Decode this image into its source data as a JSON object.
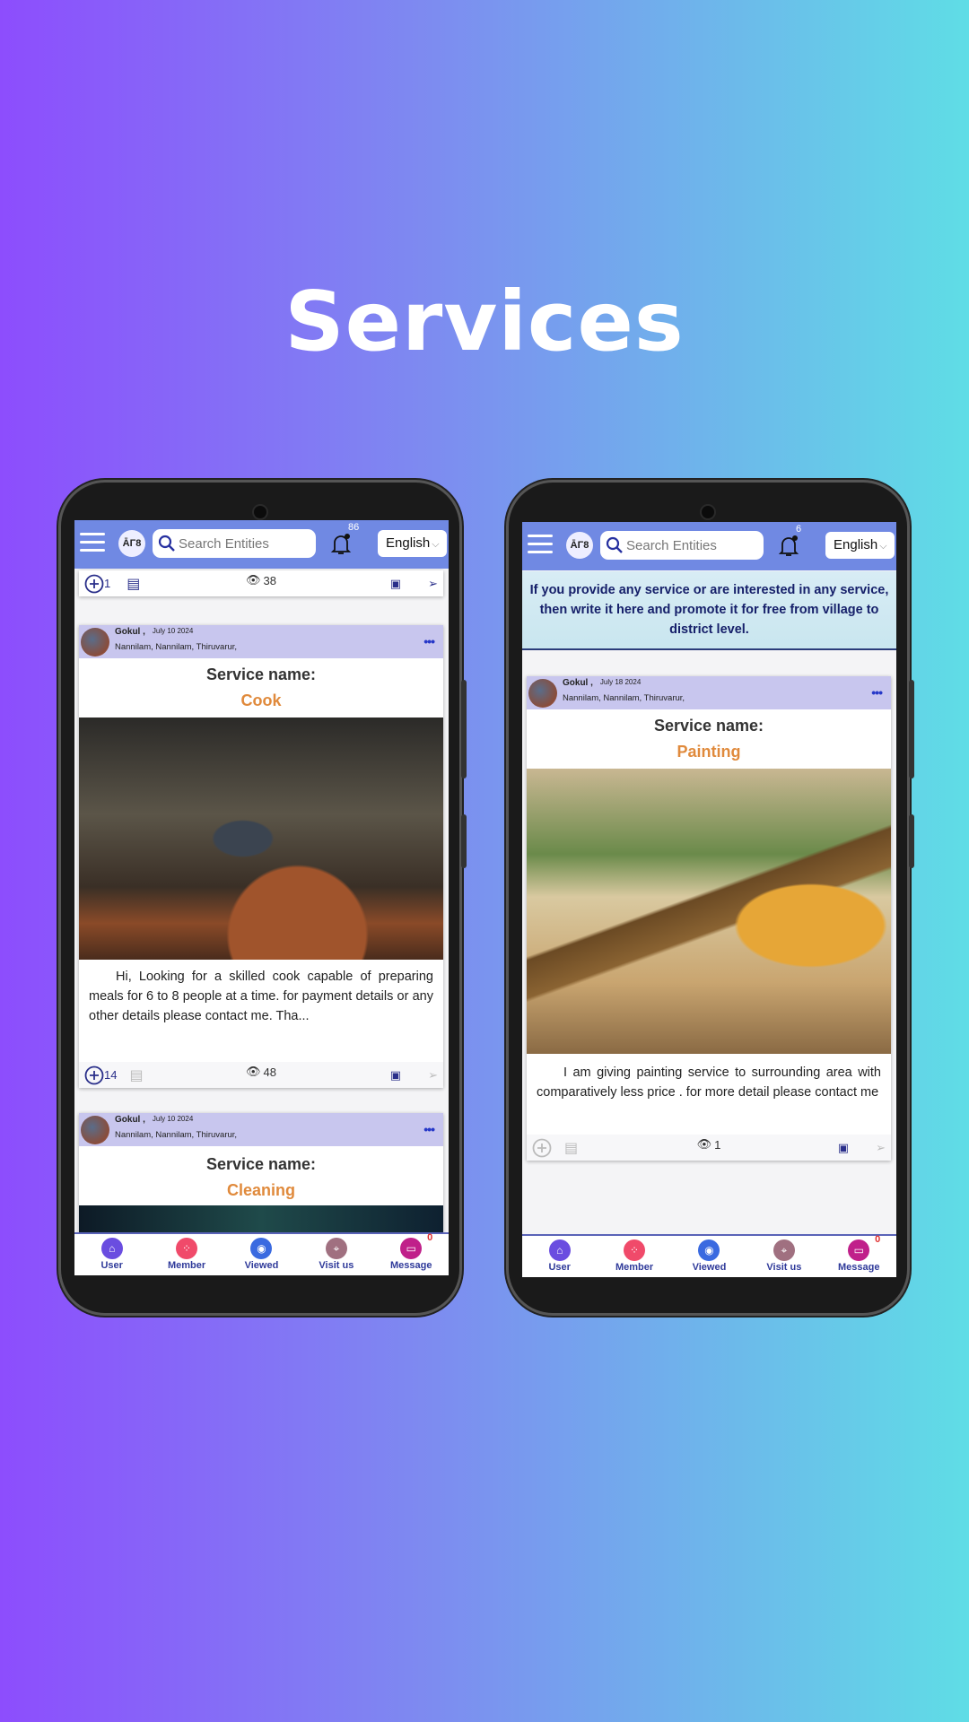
{
  "page_title": "Services",
  "header": {
    "logo_text": "ᾹΓ8",
    "search_placeholder": "Search Entities",
    "language": "English"
  },
  "phone_left": {
    "notification_count": "86",
    "top_action_bar": {
      "add_count": "1",
      "views": "38"
    },
    "posts": [
      {
        "author": "Gokul ,",
        "date": "July 10 2024",
        "location": "Nannilam,  Nannilam,  Thiruvarur,",
        "service_label": "Service name:",
        "service_name": "Cook",
        "description": "Hi, Looking for a skilled cook capable of preparing meals for 6 to 8 people at a time. for payment details or any other details please contact me. Tha...",
        "add_count": "14",
        "views": "48"
      },
      {
        "author": "Gokul ,",
        "date": "July 10 2024",
        "location": "Nannilam,  Nannilam,  Thiruvarur,",
        "service_label": "Service name:",
        "service_name": "Cleaning"
      }
    ]
  },
  "phone_right": {
    "notification_count": "6",
    "banner": "If you provide any service or are interested in any service, then write it here and promote it for free from village to district level.",
    "posts": [
      {
        "author": "Gokul ,",
        "date": "July 18 2024",
        "location": "Nannilam,  Nannilam,  Thiruvarur,",
        "service_label": "Service name:",
        "service_name": "Painting",
        "description": "I am giving painting service to surrounding area with comparatively less price . for more detail please contact me",
        "add_count": "",
        "views": "1"
      }
    ]
  },
  "bottom_nav": {
    "items": [
      {
        "label": "User",
        "icon": "home-user-icon",
        "color": "#6a4de0"
      },
      {
        "label": "Member",
        "icon": "members-icon",
        "color": "#f04a6a"
      },
      {
        "label": "Viewed",
        "icon": "eye-icon",
        "color": "#3a6ae0"
      },
      {
        "label": "Visit us",
        "icon": "location-icon",
        "color": "#a07080"
      },
      {
        "label": "Message",
        "icon": "message-icon",
        "color": "#c0208a"
      }
    ],
    "message_badge": "0"
  },
  "colors": {
    "header": "#7089e3",
    "post_header": "#c8c6ee",
    "service_name": "#e08a3c",
    "nav_text": "#2f3a9a"
  }
}
